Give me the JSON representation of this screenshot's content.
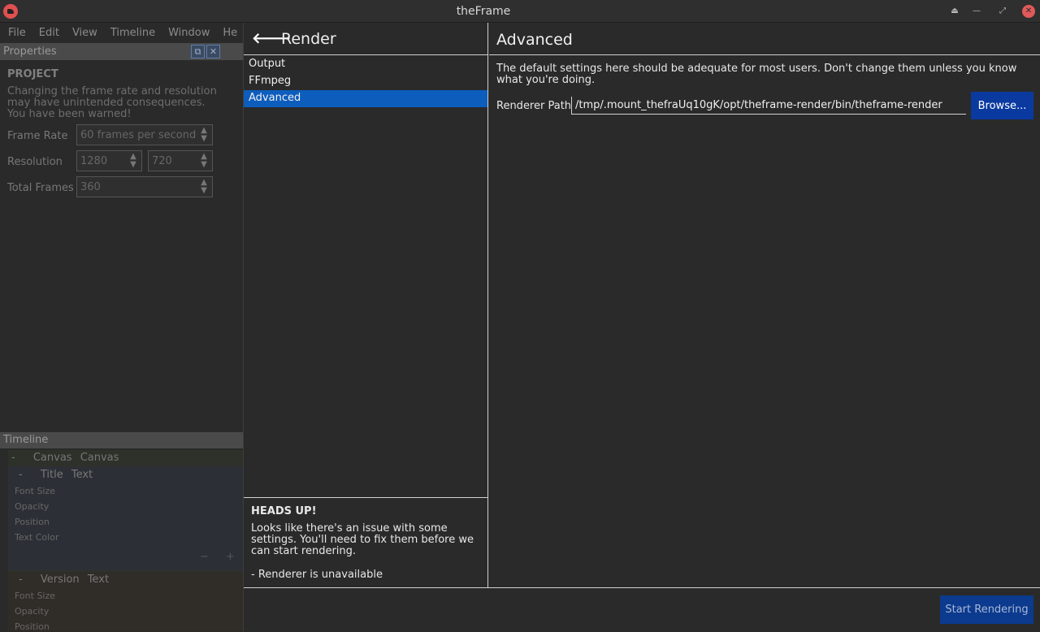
{
  "window": {
    "title": "theFrame"
  },
  "menubar": {
    "items": [
      "File",
      "Edit",
      "View",
      "Timeline",
      "Window",
      "He"
    ]
  },
  "properties": {
    "header": "Properties",
    "section": "PROJECT",
    "warning": "Changing the frame rate and resolution may have unintended consequences. You have been warned!",
    "frame_rate": {
      "label": "Frame Rate",
      "value": "60 frames per second"
    },
    "resolution": {
      "label": "Resolution",
      "width": "1280",
      "height": "720"
    },
    "total_frames": {
      "label": "Total Frames",
      "value": "360"
    }
  },
  "timeline": {
    "header": "Timeline",
    "rows": [
      {
        "toggle": "-",
        "name": "Canvas",
        "type": "Canvas"
      },
      {
        "toggle": "-",
        "name": "Title",
        "type": "Text"
      },
      {
        "toggle": "-",
        "name": "Version",
        "type": "Text"
      }
    ],
    "title_props": [
      "Font Size",
      "Opacity",
      "Position",
      "Text Color"
    ],
    "version_props": [
      "Font Size",
      "Opacity",
      "Position"
    ],
    "minus": "−",
    "plus": "+"
  },
  "render": {
    "title": "Render",
    "nav": [
      "Output",
      "FFmpeg",
      "Advanced"
    ],
    "selected": "Advanced",
    "heads_up": {
      "title": "HEADS UP!",
      "text": "Looks like there's an issue with some settings. You'll need to fix them before we can start rendering.",
      "issue": "- Renderer is unavailable"
    },
    "advanced": {
      "title": "Advanced",
      "description": "The default settings here should be adequate for most users. Don't change them unless you know what you're doing.",
      "renderer_path_label": "Renderer Path",
      "renderer_path_value": "/tmp/.mount_thefraUq10gK/opt/theframe-render/bin/theframe-render",
      "browse_label": "Browse..."
    },
    "start_label": "Start Rendering"
  }
}
